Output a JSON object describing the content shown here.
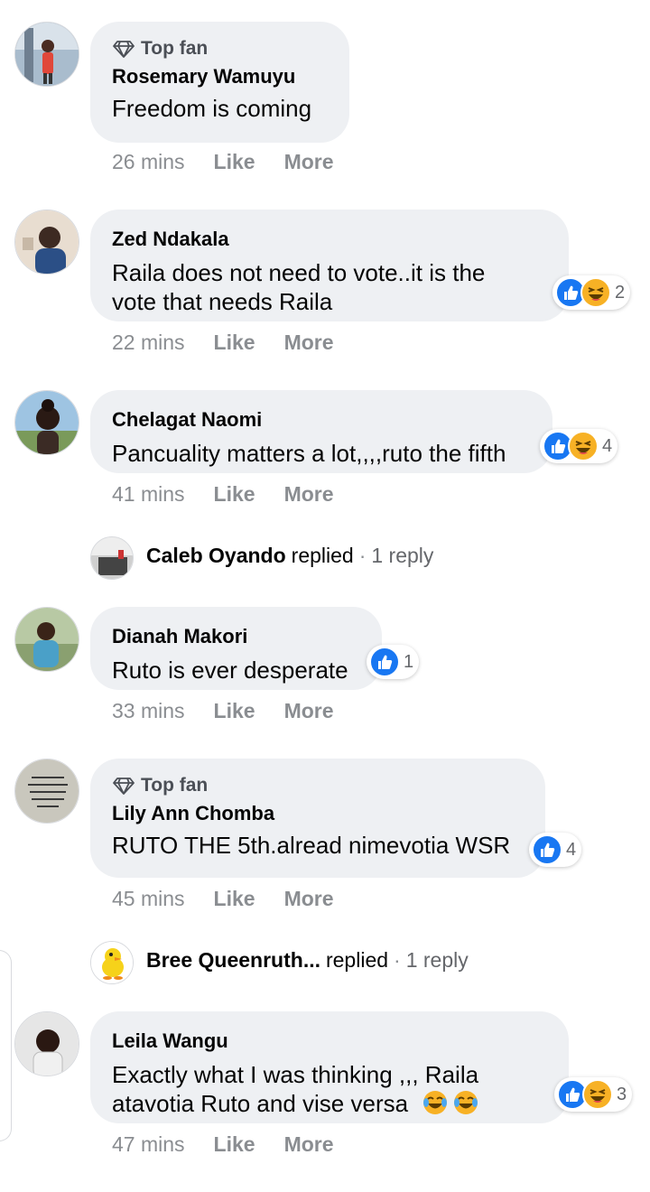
{
  "comments": [
    {
      "badge": "Top fan",
      "name": "Rosemary Wamuyu",
      "text_lines": [
        "Freedom is coming"
      ],
      "time": "26 mins",
      "like": "Like",
      "more": "More",
      "reactions": null
    },
    {
      "badge": null,
      "name": "Zed Ndakala",
      "text_lines": [
        "Raila does not need to vote..it is the",
        "vote that needs Raila"
      ],
      "time": "22 mins",
      "like": "Like",
      "more": "More",
      "reactions": {
        "icons": [
          "like-icon",
          "haha-icon"
        ],
        "count": "2"
      }
    },
    {
      "badge": null,
      "name": "Chelagat Naomi",
      "text_lines": [
        "Pancuality matters a lot,,,,ruto the fifth"
      ],
      "time": "41 mins",
      "like": "Like",
      "more": "More",
      "reactions": {
        "icons": [
          "like-icon",
          "haha-icon"
        ],
        "count": "4"
      }
    },
    {
      "badge": null,
      "name": "Dianah Makori",
      "text_lines": [
        "Ruto is ever desperate"
      ],
      "time": "33 mins",
      "like": "Like",
      "more": "More",
      "reactions": {
        "icons": [
          "like-icon"
        ],
        "count": "1"
      }
    },
    {
      "badge": "Top fan",
      "name": "Lily Ann Chomba",
      "text_lines": [
        "RUTO THE 5th.alread nimevotia WSR"
      ],
      "time": "45 mins",
      "like": "Like",
      "more": "More",
      "reactions": {
        "icons": [
          "like-icon"
        ],
        "count": "4"
      }
    },
    {
      "badge": null,
      "name": "Leila Wangu",
      "text_lines": [
        "Exactly what I was thinking ,,, Raila",
        "atavotia Ruto and vise versa"
      ],
      "time": "47 mins",
      "like": "Like",
      "more": "More",
      "reactions": {
        "icons": [
          "like-icon",
          "haha-icon"
        ],
        "count": "3"
      }
    }
  ],
  "replies": [
    {
      "name": "Caleb Oyando",
      "verb": "replied",
      "count": "1 reply"
    },
    {
      "name": "Bree Queenruth...",
      "verb": "replied",
      "count": "1 reply"
    }
  ],
  "separator": "·",
  "colors": {
    "like_blue": "#1877f2",
    "haha_yellow": "#f7b125",
    "bubble_bg": "#eef0f3",
    "meta_gray": "#8a8d91"
  }
}
